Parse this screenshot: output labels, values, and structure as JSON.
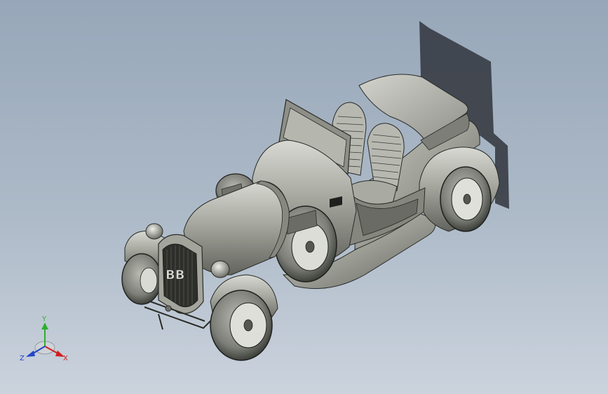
{
  "viewport": {
    "background_top": "#97a7b9",
    "background_bottom": "#cbd3dd"
  },
  "model": {
    "grille_badge": "BB",
    "body_color": "#9a9c94",
    "shadow_color": "#3c4048"
  },
  "triad": {
    "y_label": "Y",
    "x_label": "X",
    "z_label": "Z",
    "x_color": "#d21e1e",
    "y_color": "#2fae2f",
    "z_color": "#2343c8"
  }
}
